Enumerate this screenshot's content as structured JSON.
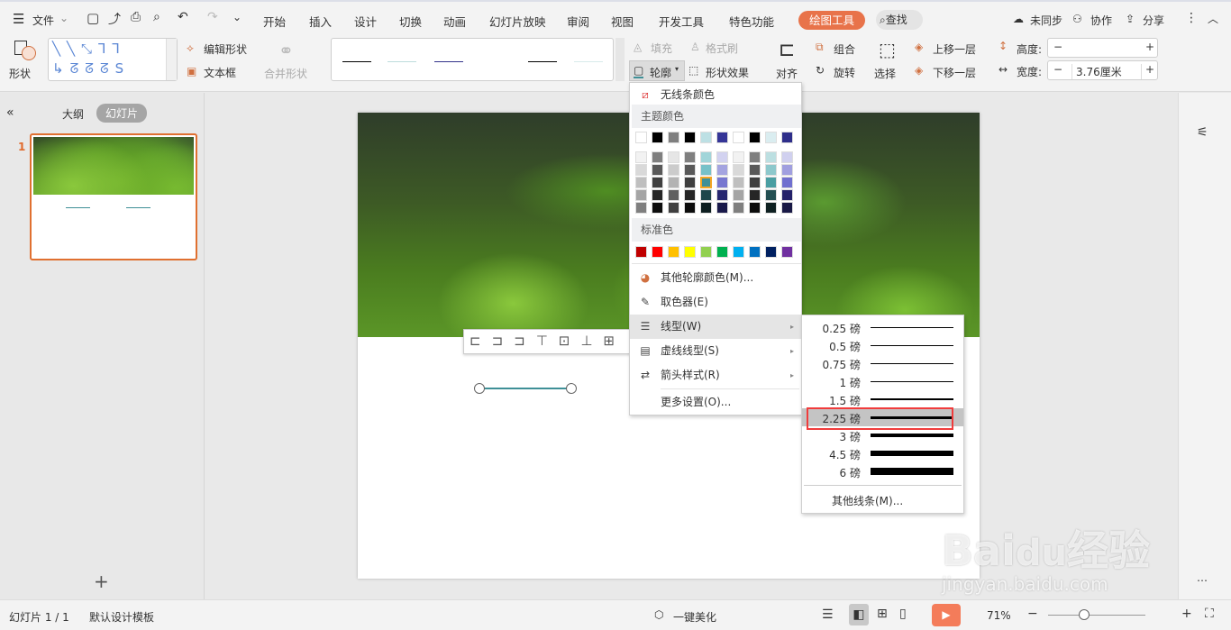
{
  "menubar": {
    "file": "文件",
    "tabs": [
      "开始",
      "插入",
      "设计",
      "切换",
      "动画",
      "幻灯片放映",
      "审阅",
      "视图",
      "开发工具",
      "特色功能"
    ],
    "active_tool_tab": "绘图工具",
    "search": "查找",
    "sync": "未同步",
    "collab": "协作",
    "share": "分享"
  },
  "ribbon": {
    "shape": "形状",
    "edit_shape": "编辑形状",
    "textbox": "文本框",
    "merge_shape": "合并形状",
    "fill": "填充",
    "format_painter": "格式刷",
    "outline": "轮廓",
    "shape_effect": "形状效果",
    "align": "对齐",
    "group": "组合",
    "rotate": "旋转",
    "select": "选择",
    "bring_forward": "上移一层",
    "send_backward": "下移一层",
    "height_label": "高度:",
    "height_value": "",
    "width_label": "宽度:",
    "width_value": "3.76厘米",
    "minus": "−",
    "plus": "+"
  },
  "leftpanel": {
    "outline_tab": "大纲",
    "slides_tab": "幻灯片",
    "slide_number": "1",
    "add": "+"
  },
  "outline_menu": {
    "no_line": "无线条颜色",
    "theme_header": "主题颜色",
    "standard_header": "标准色",
    "theme_top": [
      "#ffffff",
      "#000000",
      "#7f7f7f",
      "#000000",
      "#bde0e4",
      "#353597",
      "#ffffff",
      "#000000",
      "#daedf0",
      "#2e2e8a"
    ],
    "theme_shades": [
      [
        "#f2f2f2",
        "#7f7f7f",
        "#e6e6e6",
        "#7f7f7f",
        "#a1d5d9",
        "#d2d2f0",
        "#f2f2f2",
        "#7f7f7f",
        "#bcdfe1",
        "#d0d0ef"
      ],
      [
        "#d9d9d9",
        "#595959",
        "#cbcbcb",
        "#595959",
        "#77c1c8",
        "#a4a4e0",
        "#d9d9d9",
        "#595959",
        "#8dc8cc",
        "#a09fdf"
      ],
      [
        "#bfbfbf",
        "#3f3f3f",
        "#b3b3b3",
        "#3f3f3f",
        "#3f9097",
        "#7777d0",
        "#bfbfbf",
        "#3f3f3f",
        "#4a9ea2",
        "#7070cf"
      ],
      [
        "#a5a5a5",
        "#262626",
        "#606060",
        "#262626",
        "#1e474b",
        "#262670",
        "#a5a5a5",
        "#262626",
        "#234f52",
        "#24216a"
      ],
      [
        "#7f7f7f",
        "#0d0d0d",
        "#3f3f3f",
        "#0d0d0d",
        "#0d1e20",
        "#1a1a4b",
        "#7f7f7f",
        "#0d0d0d",
        "#0f2122",
        "#191946"
      ]
    ],
    "selected_color": "#3f9097",
    "standard": [
      "#c00000",
      "#ff0000",
      "#ffc000",
      "#ffff00",
      "#92d050",
      "#00b050",
      "#00b0f0",
      "#0070c0",
      "#002060",
      "#7030a0"
    ],
    "more_colors": "其他轮廓颜色(M)...",
    "eyedropper": "取色器(E)",
    "line_weight": "线型(W)",
    "dash_type": "虚线线型(S)",
    "arrow_style": "箭头样式(R)",
    "more_settings": "更多设置(O)..."
  },
  "weight_menu": {
    "items": [
      "0.25 磅",
      "0.5 磅",
      "0.75 磅",
      "1 磅",
      "1.5 磅",
      "2.25 磅",
      "3 磅",
      "4.5 磅",
      "6 磅"
    ],
    "weights": [
      0.25,
      0.5,
      0.75,
      1,
      1.5,
      2.25,
      3,
      4.5,
      6
    ],
    "highlighted": "2.25 磅",
    "more": "其他线条(M)..."
  },
  "status": {
    "slide_info": "幻灯片 1 / 1",
    "template": "默认设计模板",
    "beautify": "一键美化",
    "zoom": "71%",
    "zoom_fraction": 0.37
  },
  "watermark": "Baidu经验 jingyan.baidu.com",
  "colors": {
    "accent": "#e8734a",
    "line": "#3f9097",
    "highlight_box": "#f03c3c"
  }
}
